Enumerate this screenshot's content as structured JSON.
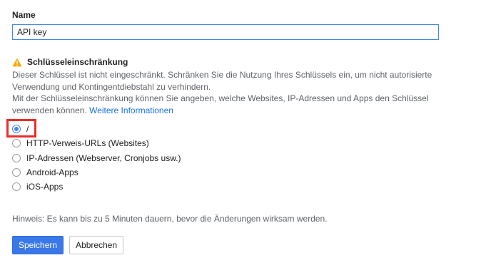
{
  "name_field": {
    "label": "Name",
    "value": "API key"
  },
  "restriction": {
    "icon": "warning-icon",
    "title": "Schlüsseleinschränkung",
    "description_1": "Dieser Schlüssel ist nicht eingeschränkt. Schränken Sie die Nutzung Ihres Schlüssels ein, um nicht autorisierte Verwendung und Kontingentdiebstahl zu verhindern.",
    "description_2": "Mit der Schlüsseleinschränkung können Sie angeben, welche Websites, IP-Adressen und Apps den Schlüssel verwenden können.",
    "link_label": "Weitere Informationen",
    "options": [
      {
        "label": "/",
        "selected": true
      },
      {
        "label": "HTTP-Verweis-URLs (Websites)",
        "selected": false
      },
      {
        "label": "IP-Adressen (Webserver, Cronjobs usw.)",
        "selected": false
      },
      {
        "label": "Android-Apps",
        "selected": false
      },
      {
        "label": "iOS-Apps",
        "selected": false
      }
    ]
  },
  "hint": "Hinweis: Es kann bis zu 5 Minuten dauern, bevor die Änderungen wirksam werden.",
  "buttons": {
    "save_label": "Speichern",
    "cancel_label": "Abbrechen"
  },
  "colors": {
    "accent": "#4285f4",
    "primary_button": "#3b78e7",
    "link": "#1a73e8",
    "warning": "#f9ab00",
    "highlight": "#ef2b2b"
  }
}
